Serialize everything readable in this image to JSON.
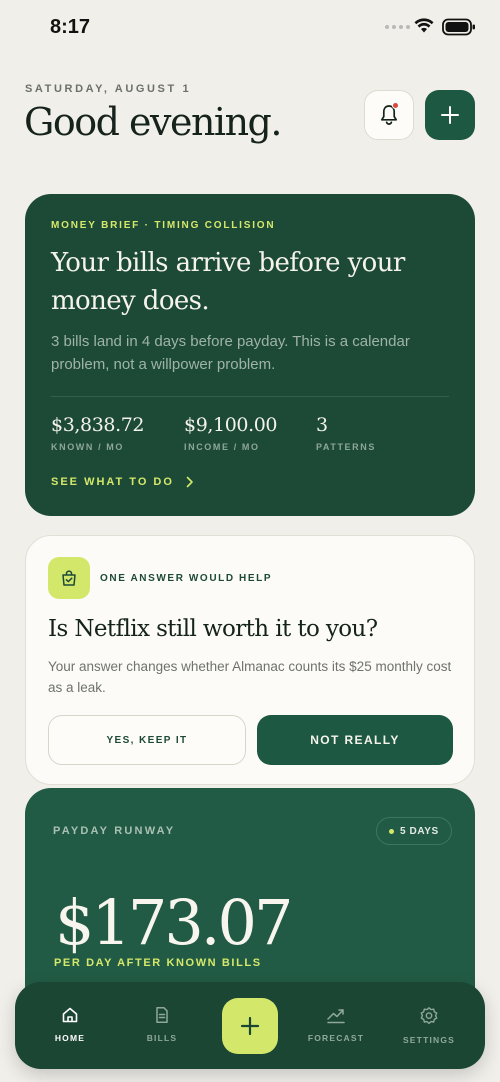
{
  "status_bar": {
    "time": "8:17"
  },
  "header": {
    "date": "SATURDAY, AUGUST 1",
    "greeting": "Good evening."
  },
  "brief": {
    "eyebrow": "MONEY BRIEF · TIMING COLLISION",
    "headline": "Your bills arrive before your money does.",
    "subtext": "3 bills land in 4 days before payday. This is a calendar problem, not a willpower problem.",
    "stats": [
      {
        "value": "$3,838.72",
        "label": "KNOWN / MO"
      },
      {
        "value": "$9,100.00",
        "label": "INCOME / MO"
      },
      {
        "value": "3",
        "label": "PATTERNS"
      }
    ],
    "cta": "SEE WHAT TO DO"
  },
  "question": {
    "eyebrow": "ONE ANSWER WOULD HELP",
    "title": "Is Netflix still worth it to you?",
    "description": "Your answer changes whether Almanac counts its $25 monthly cost as a leak.",
    "keep_label": "YES, KEEP IT",
    "not_label": "NOT REALLY"
  },
  "runway": {
    "title": "PAYDAY RUNWAY",
    "days_pill": "5 DAYS",
    "amount": "$173.07",
    "caption": "PER DAY AFTER KNOWN BILLS"
  },
  "tabbar": {
    "items": [
      {
        "label": "HOME",
        "icon": "home-icon",
        "active": true
      },
      {
        "label": "BILLS",
        "icon": "document-icon",
        "active": false
      },
      {
        "label": "FORECAST",
        "icon": "trend-icon",
        "active": false
      },
      {
        "label": "SETTINGS",
        "icon": "gear-icon",
        "active": false
      }
    ]
  },
  "colors": {
    "background": "#f1efe9",
    "primary_green": "#1d5842",
    "card_green": "#1c4a37",
    "accent_lime": "#d3e86b",
    "notification_dot": "#d9473a"
  }
}
